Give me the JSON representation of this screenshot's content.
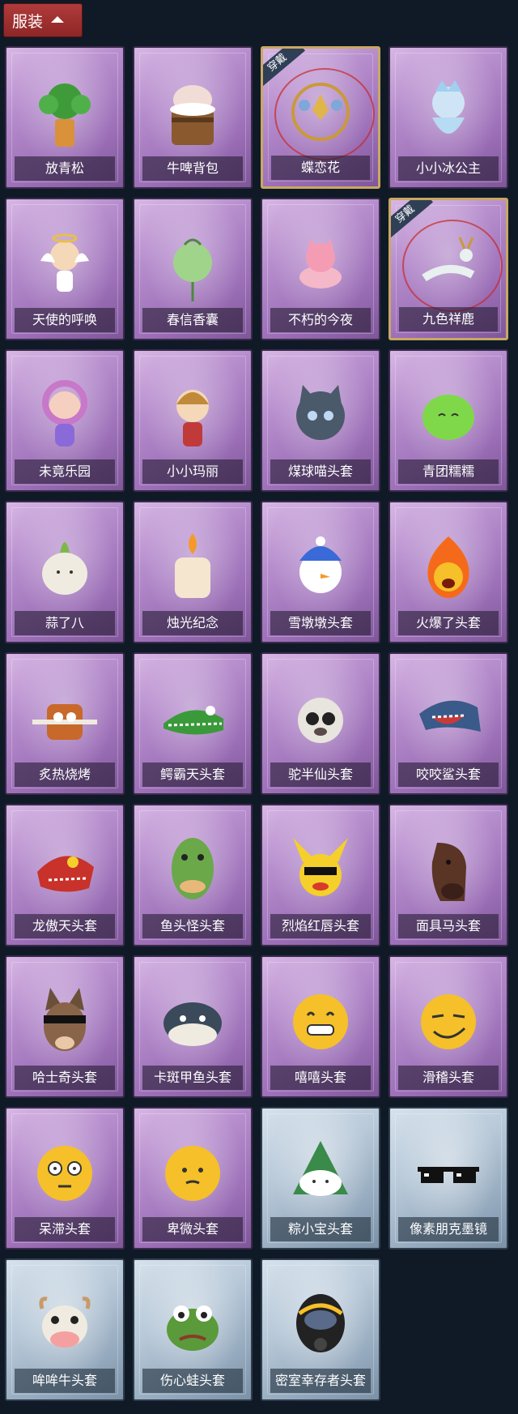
{
  "header": {
    "label": "服装"
  },
  "worn_badge": "穿戴",
  "items": [
    {
      "name": "放青松",
      "theme": "purple",
      "selected": false,
      "icon": "bonsai-icon"
    },
    {
      "name": "牛啤背包",
      "theme": "purple",
      "selected": false,
      "icon": "cow-beer-backpack-icon"
    },
    {
      "name": "蝶恋花",
      "theme": "purple",
      "selected": true,
      "icon": "butterfly-wreath-icon"
    },
    {
      "name": "小小冰公主",
      "theme": "purple",
      "selected": false,
      "icon": "ice-princess-icon"
    },
    {
      "name": "天使的呼唤",
      "theme": "purple",
      "selected": false,
      "icon": "angel-icon"
    },
    {
      "name": "春信香囊",
      "theme": "purple",
      "selected": false,
      "icon": "sachet-icon"
    },
    {
      "name": "不朽的今夜",
      "theme": "purple",
      "selected": false,
      "icon": "pink-fox-icon"
    },
    {
      "name": "九色祥鹿",
      "theme": "purple",
      "selected": true,
      "icon": "deer-icon"
    },
    {
      "name": "未竟乐园",
      "theme": "purple",
      "selected": false,
      "icon": "clown-girl-icon"
    },
    {
      "name": "小小玛丽",
      "theme": "purple",
      "selected": false,
      "icon": "doll-girl-icon"
    },
    {
      "name": "煤球喵头套",
      "theme": "purple",
      "selected": false,
      "icon": "cat-head-icon"
    },
    {
      "name": "青团糯糯",
      "theme": "purple",
      "selected": false,
      "icon": "green-dumpling-icon"
    },
    {
      "name": "蒜了八",
      "theme": "purple",
      "selected": false,
      "icon": "garlic-icon"
    },
    {
      "name": "烛光纪念",
      "theme": "purple",
      "selected": false,
      "icon": "candle-icon"
    },
    {
      "name": "雪墩墩头套",
      "theme": "purple",
      "selected": false,
      "icon": "snowman-head-icon"
    },
    {
      "name": "火爆了头套",
      "theme": "purple",
      "selected": false,
      "icon": "fire-head-icon"
    },
    {
      "name": "炙热烧烤",
      "theme": "purple",
      "selected": false,
      "icon": "bbq-meat-icon"
    },
    {
      "name": "鳄霸天头套",
      "theme": "purple",
      "selected": false,
      "icon": "crocodile-head-icon"
    },
    {
      "name": "驼半仙头套",
      "theme": "purple",
      "selected": false,
      "icon": "alpaca-head-icon"
    },
    {
      "name": "咬咬鲨头套",
      "theme": "purple",
      "selected": false,
      "icon": "shark-head-icon"
    },
    {
      "name": "龙傲天头套",
      "theme": "purple",
      "selected": false,
      "icon": "dragon-head-icon"
    },
    {
      "name": "鱼头怪头套",
      "theme": "purple",
      "selected": false,
      "icon": "fish-head-icon"
    },
    {
      "name": "烈焰红唇头套",
      "theme": "purple",
      "selected": false,
      "icon": "pikachu-head-icon"
    },
    {
      "name": "面具马头套",
      "theme": "purple",
      "selected": false,
      "icon": "horse-head-icon"
    },
    {
      "name": "哈士奇头套",
      "theme": "purple",
      "selected": false,
      "icon": "husky-head-icon"
    },
    {
      "name": "卡斑甲鱼头套",
      "theme": "purple",
      "selected": false,
      "icon": "turtle-fish-head-icon"
    },
    {
      "name": "嘻嘻头套",
      "theme": "purple",
      "selected": false,
      "icon": "grin-emoji-head-icon"
    },
    {
      "name": "滑稽头套",
      "theme": "purple",
      "selected": false,
      "icon": "smirk-emoji-head-icon"
    },
    {
      "name": "呆滞头套",
      "theme": "purple",
      "selected": false,
      "icon": "dazed-emoji-head-icon"
    },
    {
      "name": "卑微头套",
      "theme": "purple",
      "selected": false,
      "icon": "humble-emoji-head-icon"
    },
    {
      "name": "粽小宝头套",
      "theme": "blue",
      "selected": false,
      "icon": "zongzi-head-icon"
    },
    {
      "name": "像素朋克墨镜",
      "theme": "blue",
      "selected": false,
      "icon": "pixel-sunglasses-icon"
    },
    {
      "name": "哞哞牛头套",
      "theme": "blue",
      "selected": false,
      "icon": "cow-head-icon"
    },
    {
      "name": "伤心蛙头套",
      "theme": "blue",
      "selected": false,
      "icon": "sad-frog-head-icon"
    },
    {
      "name": "密室幸存者头套",
      "theme": "blue",
      "selected": false,
      "icon": "gas-mask-head-icon"
    }
  ]
}
